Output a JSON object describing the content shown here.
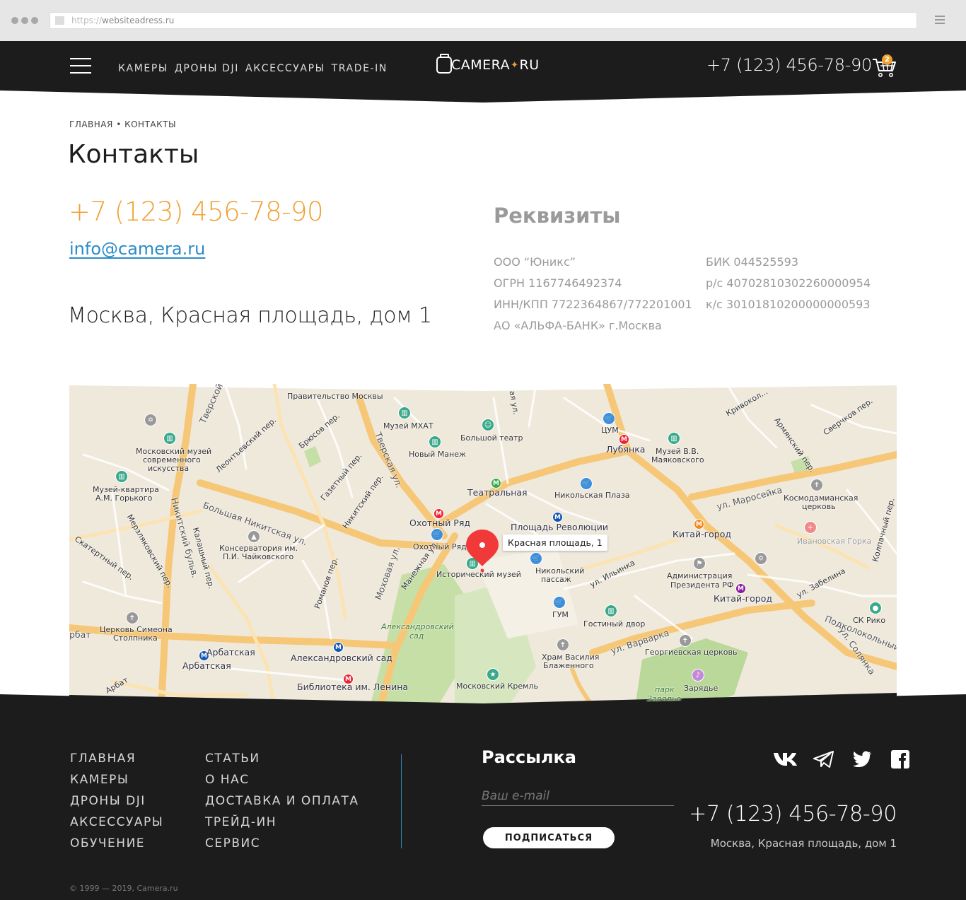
{
  "browser": {
    "url_protocol": "https://",
    "url_host": "websiteadress.ru"
  },
  "header": {
    "nav": [
      "КАМЕРЫ",
      "ДРОНЫ DJI",
      "АКСЕССУАРЫ",
      "TRADE-IN"
    ],
    "logo_left": "CAMERA",
    "logo_right": "RU",
    "phone": "+7 (123) 456-78-90",
    "cart_count": "2"
  },
  "breadcrumb": {
    "home": "ГЛАВНАЯ",
    "separator": "•",
    "current": "КОНТАКТЫ"
  },
  "page_title": "Контакты",
  "contacts": {
    "phone": "+7 (123) 456-78-90",
    "email": "info@camera.ru",
    "address": "Москва, Красная площадь, дом 1"
  },
  "requisites": {
    "title": "Реквизиты",
    "col1": [
      "ООО “Юникс”",
      "ОГРН 1167746492374",
      "ИНН/КПП 7722364867/772201001",
      "АО «АЛЬФА-БАНК» г.Москва"
    ],
    "col2": [
      "БИК 044525593",
      "р/с 40702810302260000954",
      "к/с 30101810200000000593"
    ]
  },
  "map": {
    "pin_label": "Красная площадь, 1",
    "labels": {
      "pravitelstvo": "Правительство Москвы",
      "mhat": "Музей МХАТ",
      "bolshoi": "Большой театр",
      "tsum": "ЦУМ",
      "lubyanka": "Лубянка",
      "mayakovsky1": "Музей В.В.",
      "mayakovsky2": "Маяковского",
      "mmsi1": "Московский музей",
      "mmsi2": "современного",
      "mmsi3": "искусства",
      "novy_manezh": "Новый Манеж",
      "teatralnaya": "Театральная",
      "nikolskaya_plaza": "Никольская Плаза",
      "gorky1": "Музей-квартира",
      "gorky2": "А.М. Горького",
      "okhotny": "Охотный Ряд",
      "okhotny2": "Охотный Ряд",
      "pl_revolyutsii": "Площадь Революции",
      "kitay_gorod": "Китай-город",
      "kitay_gorod2": "Китай-город",
      "kosmodamian1": "Космодамианская",
      "kosmodamian2": "церковь",
      "ivanovskaya": "Ивановская Горка",
      "conserv1": "Консерватория им.",
      "conserv2": "П.И. Чайковского",
      "hist_museum": "Исторический музей",
      "nikolsky1": "Никольский",
      "nikolsky2": "пассаж",
      "admin1": "Администрация",
      "admin2": "Президента РФ",
      "gum": "ГУМ",
      "gostiny": "Гостиный двор",
      "sk_riko": "СК Рико",
      "simeon1": "Церковь Симеона",
      "simeon2": "Столпника",
      "arbatskaya": "Арбатская",
      "arbatskaya2": "Арбатская",
      "alex_sad": "Александровский сад",
      "alex_sad_park1": "Александровский",
      "alex_sad_park2": "сад",
      "vasily1": "Храм Василия",
      "vasily2": "Блаженного",
      "georgiev": "Георгиевская церковь",
      "lenin_lib": "Библиотека им. Ленина",
      "kremlin": "Московский Кремль",
      "zaryadye": "Зарядье",
      "park_zaryadye1": "парк",
      "park_zaryadye2": "Зарядье"
    },
    "streets": {
      "tverskaya": "Тверская ул.",
      "tverskoy": "Тверской",
      "mokhovaya": "Моховая ул.",
      "b_nikitskaya": "Большая Никитская ул.",
      "nikitsky": "Никитский бульв.",
      "maroseyka": "ул. Маросейка",
      "varvarka": "ул. Варварка",
      "ilyinka": "ул. Ильинка",
      "solyanka": "ул. Солянка",
      "leontievsky": "Леонтьевский пер.",
      "bryusov": "Брюсов пер.",
      "gazetny": "Газетный пер.",
      "nikitsky_per": "Никитский пер.",
      "merzlyakovsky": "Мерзляковский пер.",
      "skatertny": "Скатертный пер.",
      "kalashny": "Калашный пер.",
      "romanov": "Романов пер.",
      "manezhnaya": "Манежная ул.",
      "nikolskaya": "Никольская ул.",
      "armyansky": "Армянский пер.",
      "sverchkov": "Сверчков пер.",
      "krivokol": "Кривокол...",
      "kolpachny": "Колпачный пер.",
      "zabelina": "ул. Забелина",
      "podkolokolny": "Подколокольный",
      "arbat": "Арбат",
      "bat": "рбат",
      "ul_short": "ул.",
      "iul": "ая ул."
    }
  },
  "footer": {
    "nav1": [
      "ГЛАВНАЯ",
      "КАМЕРЫ",
      "ДРОНЫ DJI",
      "АКСЕССУАРЫ",
      "ОБУЧЕНИЕ"
    ],
    "nav2": [
      "СТАТЬИ",
      "О НАС",
      "ДОСТАВКА И ОПЛАТА",
      "ТРЕЙД-ИН",
      "СЕРВИС"
    ],
    "newsletter_title": "Рассылка",
    "email_placeholder": "Ваш e-mail",
    "subscribe_label": "ПОДПИСАТЬСЯ",
    "phone": "+7 (123) 456-78-90",
    "address": "Москва, Красная площадь, дом 1",
    "copyright": "© 1999 — 2019, Camera.ru",
    "socials": [
      "vk-icon",
      "telegram-icon",
      "twitter-icon",
      "facebook-icon"
    ]
  },
  "colors": {
    "accent": "#f0a030",
    "link": "#2a8bc9",
    "dark": "#1c1c1c"
  }
}
